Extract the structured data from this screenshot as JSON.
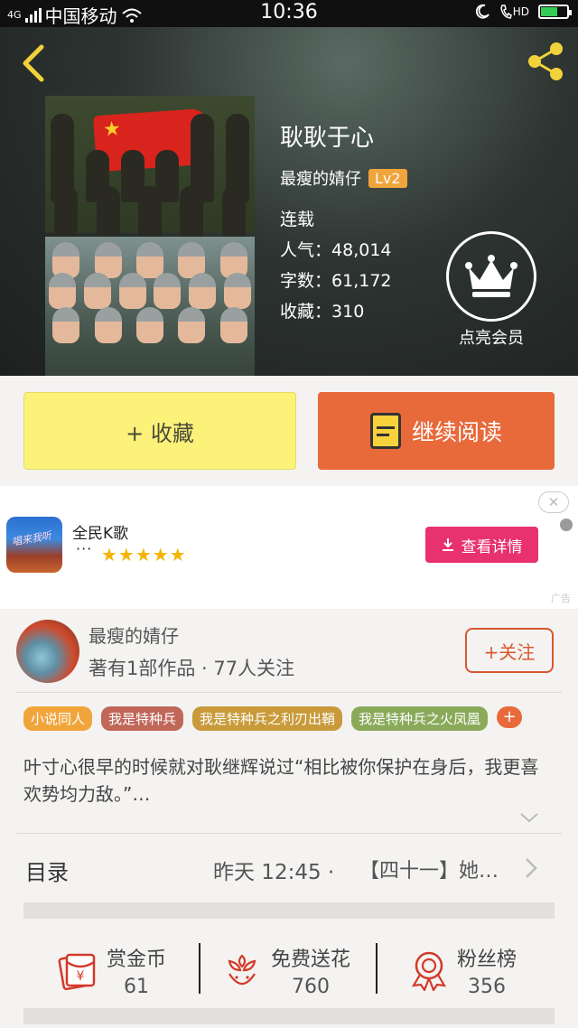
{
  "status_bar": {
    "network": "4G",
    "carrier": "中国移动",
    "time": "10:36",
    "hd": "HD",
    "battery_level": 0.6,
    "battery_color": "#33cc55"
  },
  "book": {
    "title": "耿耿于心",
    "author": "最瘦的婧仔",
    "level": "Lv2",
    "status": "连载",
    "popularity_label": "人气：",
    "popularity": "48,014",
    "words_label": "字数：",
    "words": "61,172",
    "favorites_label": "收藏：",
    "favorites": "310"
  },
  "vip": {
    "label": "点亮会员",
    "icon": "crown-icon"
  },
  "actions": {
    "collect_label": "+ 收藏",
    "read_label": "继续阅读",
    "collect_color": "#fcf27a",
    "read_color": "#e8693a"
  },
  "ad": {
    "app_name": "全民K歌",
    "icon_text": "唱来我听",
    "dots": "···",
    "stars": "★★★★★",
    "button_label": "查看详情",
    "close_symbol": "✕",
    "ad_mark": "广告",
    "button_color": "#e8316f"
  },
  "author_card": {
    "name": "最瘦的婧仔",
    "meta": "著有1部作品 · 77人关注",
    "follow_label": "+关注",
    "tags": [
      {
        "label": "小说同人",
        "color": "#f0a53b"
      },
      {
        "label": "我是特种兵",
        "color": "#c0675a"
      },
      {
        "label": "我是特种兵之利刃出鞘",
        "color": "#c99a3a"
      },
      {
        "label": "我是特种兵之火凤凰",
        "color": "#8aaa5a"
      }
    ],
    "tag_more": "+",
    "intro": "叶寸心很早的时候就对耿继辉说过“相比被你保护在身后，我更喜欢势均力敌。”…"
  },
  "toc": {
    "label": "目录",
    "updated": "昨天 12:45",
    "separator": "·",
    "latest_chapter": "【四十一】她…"
  },
  "bottom_stats": [
    {
      "label": "赏金币",
      "value": "61",
      "icon": "red-envelope-icon"
    },
    {
      "label": "免费送花",
      "value": "760",
      "icon": "flower-icon"
    },
    {
      "label": "粉丝榜",
      "value": "356",
      "icon": "medal-icon"
    }
  ]
}
